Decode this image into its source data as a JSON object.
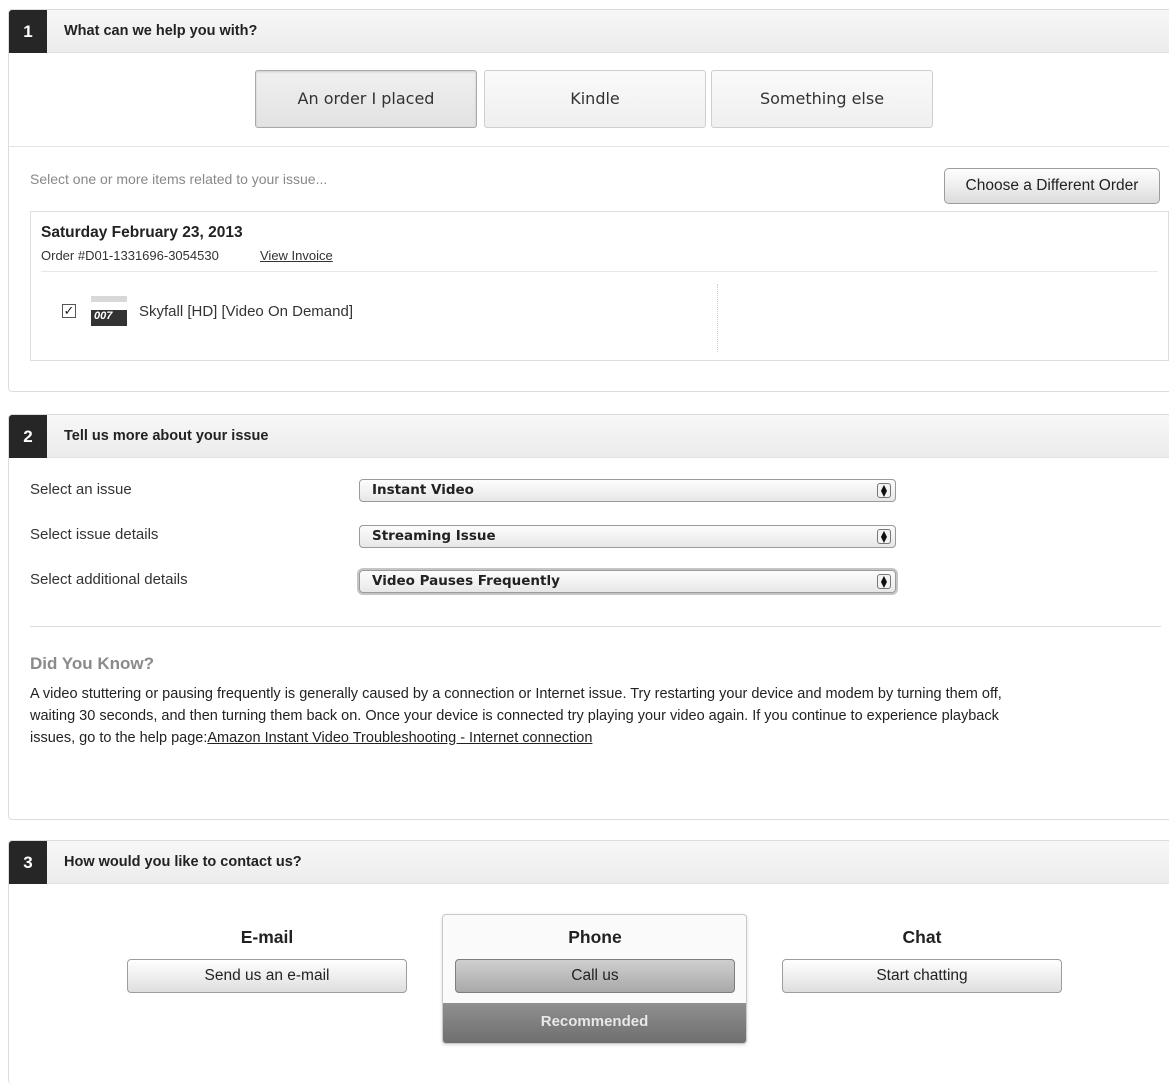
{
  "section1": {
    "number": "1",
    "title": "What can we help you with?",
    "categories": [
      "An order I placed",
      "Kindle",
      "Something else"
    ],
    "hint": "Select one or more items related to your issue...",
    "different_order_button": "Choose a Different Order",
    "order": {
      "date": "Saturday February 23, 2013",
      "number": "Order #D01-1331696-3054530",
      "view_invoice": "View Invoice",
      "item_name": "Skyfall [HD] [Video On Demand]",
      "item_checked": true,
      "thumb_text": "007"
    }
  },
  "section2": {
    "number": "2",
    "title": "Tell us more about your issue",
    "fields": [
      {
        "label": "Select an issue",
        "value": "Instant Video"
      },
      {
        "label": "Select issue details",
        "value": "Streaming Issue"
      },
      {
        "label": "Select additional details",
        "value": "Video Pauses Frequently"
      }
    ],
    "did_you_know": {
      "title": "Did You Know?",
      "body": "A video stuttering or pausing frequently is generally caused by a connection or Internet issue. Try restarting your device and modem by turning them off, waiting 30 seconds, and then turning them back on. Once your device is connected try playing your video again. If you continue to experience playback issues, go to the help page:",
      "link": "Amazon Instant Video Troubleshooting - Internet connection"
    }
  },
  "section3": {
    "number": "3",
    "title": "How would you like to contact us?",
    "email": {
      "label": "E-mail",
      "button": "Send us an e-mail"
    },
    "phone": {
      "label": "Phone",
      "button": "Call us",
      "badge": "Recommended"
    },
    "chat": {
      "label": "Chat",
      "button": "Start chatting"
    }
  },
  "icons": {
    "checkbox": "checkbox-checked-icon",
    "select_arrows": "up-down-arrows-icon",
    "thumbnail": "movie-thumbnail-icon"
  }
}
